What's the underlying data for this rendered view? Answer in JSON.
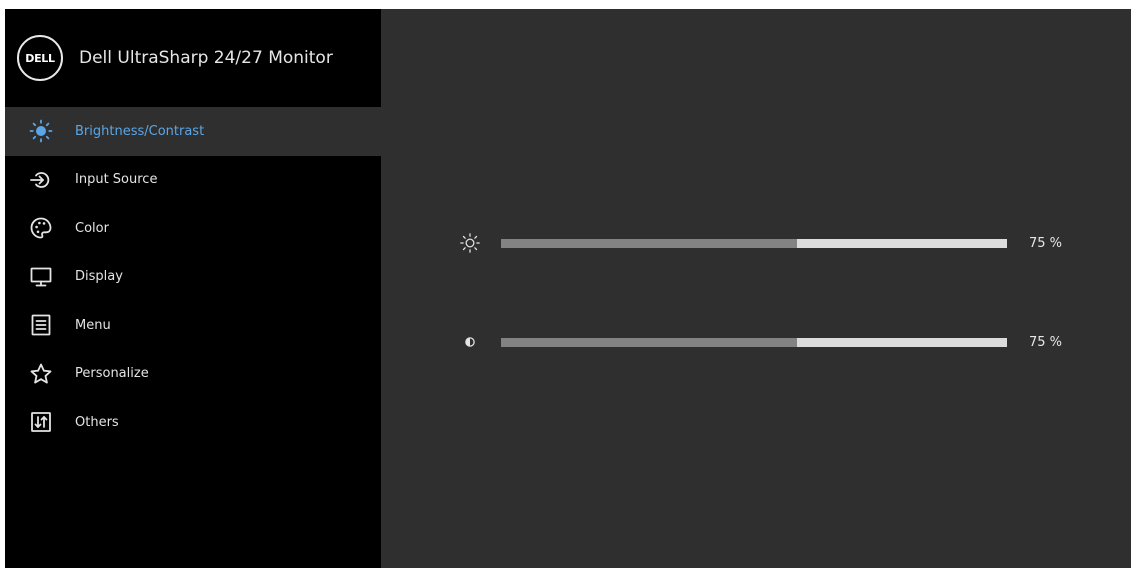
{
  "header": {
    "logo_text": "DELL",
    "title": "Dell UltraSharp 24/27 Monitor"
  },
  "colors": {
    "accent": "#5aa6e6",
    "sidebar_bg": "#000000",
    "panel_bg": "#2f2f2f",
    "track_bg": "#dcdcdc",
    "track_fill": "#838383"
  },
  "menu": {
    "active_index": 0,
    "items": [
      {
        "label": "Brightness/Contrast",
        "icon": "sun-icon"
      },
      {
        "label": "Input Source",
        "icon": "input-source-icon"
      },
      {
        "label": "Color",
        "icon": "palette-icon"
      },
      {
        "label": "Display",
        "icon": "monitor-icon"
      },
      {
        "label": "Menu",
        "icon": "menu-list-icon"
      },
      {
        "label": "Personalize",
        "icon": "star-icon"
      },
      {
        "label": "Others",
        "icon": "others-icon"
      }
    ]
  },
  "sliders": {
    "brightness": {
      "icon": "brightness-icon",
      "value": 75,
      "value_text": "75 %"
    },
    "contrast": {
      "icon": "contrast-icon",
      "value": 75,
      "value_text": "75 %"
    }
  }
}
